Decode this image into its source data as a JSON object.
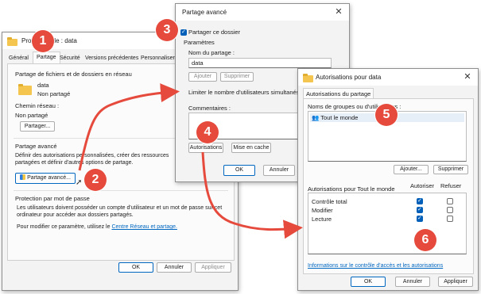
{
  "props_window": {
    "title": "Propriétés de : data",
    "tabs": [
      "Général",
      "Partage",
      "Sécurité",
      "Versions précédentes",
      "Personnaliser"
    ],
    "network_group_title": "Partage de fichiers et de dossiers en réseau",
    "folder_name": "data",
    "folder_status": "Non partagé",
    "network_path_label": "Chemin réseau :",
    "network_path_value": "Non partagé",
    "share_button": "Partager...",
    "advanced_group_title": "Partage avancé",
    "advanced_desc": "Définir des autorisations personnalisées, créer des ressources partagées et définir d'autres options de partage.",
    "advanced_button": "Partage avancé...",
    "password_group_title": "Protection par mot de passe",
    "password_desc": "Les utilisateurs doivent posséder un compte d'utilisateur et un mot de passe sur cet ordinateur pour accéder aux dossiers partagés.",
    "password_change_text": "Pour modifier ce paramètre, utilisez le",
    "password_link": "Centre Réseau et partage.",
    "ok": "OK",
    "cancel": "Annuler",
    "apply": "Appliquer"
  },
  "advanced_window": {
    "title": "Partage avancé",
    "share_checkbox": "Partager ce dossier",
    "params_label": "Paramètres",
    "share_name_label": "Nom du partage :",
    "share_name_value": "data",
    "add": "Ajouter",
    "remove": "Supprimer",
    "limit_label": "Limiter le nombre d'utilisateurs simultanés à :",
    "comments_label": "Commentaires :",
    "permissions_button": "Autorisations",
    "cache_button": "Mise en cache",
    "ok": "OK",
    "cancel": "Annuler"
  },
  "perm_window": {
    "title": "Autorisations pour data",
    "tab": "Autorisations du partage",
    "groups_label": "Noms de groupes ou d'utilisateurs :",
    "everyone": "Tout le monde",
    "add": "Ajouter...",
    "remove": "Supprimer",
    "perms_for": "Autorisations pour Tout le monde",
    "allow": "Autoriser",
    "deny": "Refuser",
    "rows": [
      {
        "name": "Contrôle total",
        "allow": true,
        "deny": false
      },
      {
        "name": "Modifier",
        "allow": true,
        "deny": false
      },
      {
        "name": "Lecture",
        "allow": true,
        "deny": false
      }
    ],
    "link": "Informations sur le contrôle d'accès et les autorisations",
    "ok": "OK",
    "cancel": "Annuler",
    "apply": "Appliquer"
  },
  "badges": [
    "1",
    "2",
    "3",
    "4",
    "5",
    "6"
  ],
  "colors": {
    "badge": "#e54a3c",
    "arrow": "#e54a3c",
    "accent": "#0067c0"
  }
}
